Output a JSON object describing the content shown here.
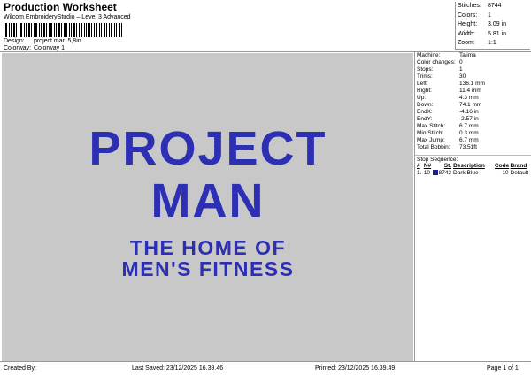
{
  "header": {
    "title": "Production Worksheet",
    "software": "Wilcom EmbroideryStudio – Level 3 Advanced",
    "design_label": "Design:",
    "design_value": "project man 5,8in",
    "colorway_label": "Colorway:",
    "colorway_value": "Colorway 1"
  },
  "stats": [
    {
      "k": "Stitches:",
      "v": "8744"
    },
    {
      "k": "Colors:",
      "v": "1"
    },
    {
      "k": "Height:",
      "v": "3.09 in"
    },
    {
      "k": "Width:",
      "v": "5.81 in"
    },
    {
      "k": "Zoom:",
      "v": "1:1"
    }
  ],
  "design_text": {
    "line1": "PROJECT",
    "line2": "MAN",
    "line3": "THE HOME OF",
    "line4": "MEN'S FITNESS",
    "thread_color": "#2a2cb0"
  },
  "machine": [
    {
      "k": "Machine:",
      "v": "Tajima"
    },
    {
      "k": "Color changes:",
      "v": "0"
    },
    {
      "k": "Stops:",
      "v": "1"
    },
    {
      "k": "Trims:",
      "v": "30"
    },
    {
      "k": "Left:",
      "v": "136.1 mm"
    },
    {
      "k": "Right:",
      "v": "11.4 mm"
    },
    {
      "k": "Up:",
      "v": "4.3 mm"
    },
    {
      "k": "Down:",
      "v": "74.1 mm"
    },
    {
      "k": "EndX:",
      "v": "-4.16 in"
    },
    {
      "k": "EndY:",
      "v": "-2.57 in"
    },
    {
      "k": "Max Stitch:",
      "v": "6.7 mm"
    },
    {
      "k": "Min Stitch:",
      "v": "0.3 mm"
    },
    {
      "k": "Max Jump:",
      "v": "6.7 mm"
    },
    {
      "k": "Total Bobbin:",
      "v": "73.51ft"
    }
  ],
  "stop_sequence": {
    "title": "Stop Sequence:",
    "headers": [
      "#",
      "N#",
      "St.",
      "Description",
      "Code",
      "Brand"
    ],
    "rows": [
      {
        "num": "1.",
        "n": "10",
        "st": "8742",
        "desc": "Dark Blue",
        "code": "10",
        "brand": "Default",
        "swatch": "#1c1e8e"
      }
    ]
  },
  "footer": {
    "created_by": "Created By:",
    "last_saved": "Last Saved: 23/12/2025 16.39.46",
    "printed": "Printed: 23/12/2025 16.39.49",
    "page": "Page 1 of 1"
  }
}
